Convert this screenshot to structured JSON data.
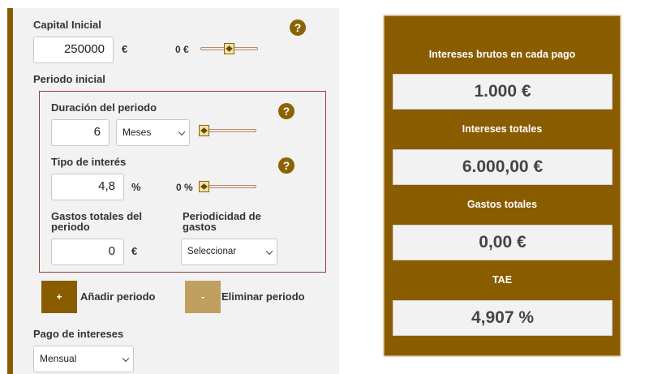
{
  "form": {
    "capital": {
      "label": "Capital Inicial",
      "value": "250000",
      "unit": "€",
      "slider_value": "0 €"
    },
    "periodo_inicial": {
      "label": "Periodo inicial"
    },
    "duracion": {
      "label": "Duración del periodo",
      "value": "6",
      "unit_select": "Meses"
    },
    "tipo": {
      "label": "Tipo de interés",
      "value": "4,8",
      "unit": "%",
      "slider_value": "0 %"
    },
    "gastos": {
      "label_line1": "Gastos totales del",
      "label_line2": "periodo",
      "value": "0",
      "unit": "€"
    },
    "periodicidad": {
      "label_line1": "Periodicidad de",
      "label_line2": "gastos",
      "select": "Seleccionar"
    },
    "add_period": {
      "symbol": "+",
      "label": "Añadir periodo"
    },
    "remove_period": {
      "symbol": "-",
      "label": "Eliminar periodo"
    },
    "pago": {
      "label": "Pago de intereses",
      "select": "Mensual"
    },
    "help_symbol": "?"
  },
  "results": {
    "intereses_brutos": {
      "label": "Intereses brutos en cada pago",
      "value": "1.000 €"
    },
    "intereses_totales": {
      "label": "Intereses totales",
      "value": "6.000,00 €"
    },
    "gastos_totales": {
      "label": "Gastos totales",
      "value": "0,00 €"
    },
    "tae": {
      "label": "TAE",
      "value": "4,907 %"
    }
  },
  "colors": {
    "brand_brown": "#8a5c00",
    "add_button": "#8a5c00",
    "remove_button": "#c0a060"
  },
  "icons": {
    "help": "question-circle-icon",
    "slider": "slider-thumb-icon",
    "select": "chevron-down-icon"
  }
}
